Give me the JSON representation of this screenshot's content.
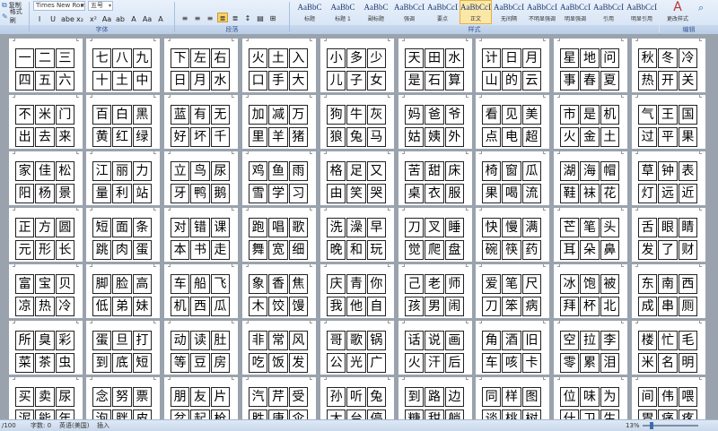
{
  "ribbon": {
    "clipboard": {
      "copy": "复制",
      "format_painter": "格式刷"
    },
    "font_name": "Times New Roman",
    "font_size": "五号",
    "group_labels": {
      "font": "字体",
      "paragraph": "段落",
      "styles": "样式",
      "editing": "编辑"
    },
    "font_buttons": [
      "I",
      "U",
      "abe",
      "x₂",
      "x²",
      "Aa",
      "ab",
      "A",
      "Aa",
      "A"
    ],
    "para_buttons": [
      "≡",
      "≡",
      "≡",
      "≣",
      "≣",
      "↕",
      "▤",
      "⊞"
    ],
    "styles": [
      {
        "preview": "AaBbC",
        "name": "标题"
      },
      {
        "preview": "AaBbC",
        "name": "标题 1"
      },
      {
        "preview": "AaBbC",
        "name": "副标题"
      },
      {
        "preview": "AaBbCcDt",
        "name": "强调"
      },
      {
        "preview": "AaBbCcD",
        "name": "要点"
      },
      {
        "preview": "AaBbCcDc",
        "name": "正文"
      },
      {
        "preview": "AaBbCcDc",
        "name": "无间隔"
      },
      {
        "preview": "AaBbCcDt",
        "name": "不明显强调"
      },
      {
        "preview": "AaBbCcDt",
        "name": "明显强调"
      },
      {
        "preview": "AaBbCcDc",
        "name": "引用"
      },
      {
        "preview": "AaBbCcDc",
        "name": "明显引用"
      }
    ],
    "change_styles_label": "更改样式",
    "accent_color": "#f7d36a"
  },
  "pages": [
    [
      "一二三",
      "四五六"
    ],
    [
      "七八九",
      "十土中"
    ],
    [
      "下左右",
      "日月水"
    ],
    [
      "火土入",
      "口手大"
    ],
    [
      "小多少",
      "儿子女"
    ],
    [
      "天田水",
      "是石算"
    ],
    [
      "计日月",
      "山的云"
    ],
    [
      "星地问",
      "事春夏"
    ],
    [
      "秋冬冷",
      "热开关"
    ],
    [
      "不米门",
      "出去来"
    ],
    [
      "百白黑",
      "黄红绿"
    ],
    [
      "蓝有无",
      "好坏千"
    ],
    [
      "加减万",
      "里羊猪"
    ],
    [
      "狗牛灰",
      "狼兔马"
    ],
    [
      "妈爸爷",
      "姑姨外"
    ],
    [
      "看见美",
      "点电超"
    ],
    [
      "市是机",
      "火金土"
    ],
    [
      "气王国",
      "过平果"
    ],
    [
      "家佳松",
      "阳杨景"
    ],
    [
      "江丽力",
      "量利站"
    ],
    [
      "立鸟尿",
      "牙鸭鹅"
    ],
    [
      "鸡鱼雨",
      "雪学习"
    ],
    [
      "格足又",
      "由笑哭"
    ],
    [
      "苦甜床",
      "桌衣服"
    ],
    [
      "椅窗瓜",
      "果喝流"
    ],
    [
      "湖海帽",
      "鞋袜花"
    ],
    [
      "草钟表",
      "灯远近"
    ],
    [
      "正方圆",
      "元形长"
    ],
    [
      "短面条",
      "跳肉蛋"
    ],
    [
      "对错课",
      "本书走"
    ],
    [
      "跑唱歌",
      "舞宽细"
    ],
    [
      "洗澡早",
      "晚和玩"
    ],
    [
      "刀叉睡",
      "觉爬盘"
    ],
    [
      "快慢满",
      "碗筷药"
    ],
    [
      "芒笔头",
      "耳朵鼻"
    ],
    [
      "舌眼睛",
      "发了财"
    ],
    [
      "富宝贝",
      "凉热冷"
    ],
    [
      "脚脸高",
      "低弟妹"
    ],
    [
      "车船飞",
      "机西瓜"
    ],
    [
      "象香焦",
      "木饺馒"
    ],
    [
      "庆青你",
      "我他自"
    ],
    [
      "己老师",
      "孩男闹"
    ],
    [
      "爱笔尺",
      "刀笨病"
    ],
    [
      "冰饱被",
      "拜杯北"
    ],
    [
      "东南西",
      "成串厕"
    ],
    [
      "所臭彩",
      "菜茶虫"
    ],
    [
      "蛋旦打",
      "到底短"
    ],
    [
      "动读肚",
      "等豆房"
    ],
    [
      "非常风",
      "吃饭发"
    ],
    [
      "哥歌锅",
      "公光广"
    ],
    [
      "话说画",
      "火汗后"
    ],
    [
      "角酒旧",
      "车咳卡"
    ],
    [
      "空拉李",
      "零累泪"
    ],
    [
      "楼忙毛",
      "米名明"
    ],
    [
      "买卖尿",
      "泥能年"
    ],
    [
      "念努票",
      "泡胖皮"
    ],
    [
      "朋友片",
      "盆起枪"
    ],
    [
      "汽芹受",
      "胜唐伞"
    ],
    [
      "孙听兔",
      "太台停"
    ],
    [
      "到路边",
      "糖甜躺"
    ],
    [
      "同样图",
      "谈桃树"
    ],
    [
      "位味为",
      "什卫生"
    ],
    [
      "间伟喂",
      "胃痛疼"
    ]
  ],
  "status": {
    "page": "/100",
    "words_label": "字数: 0",
    "lang": "英语(美国)",
    "mode": "插入",
    "zoom": "13%",
    "zoom_fraction": 0.13
  }
}
